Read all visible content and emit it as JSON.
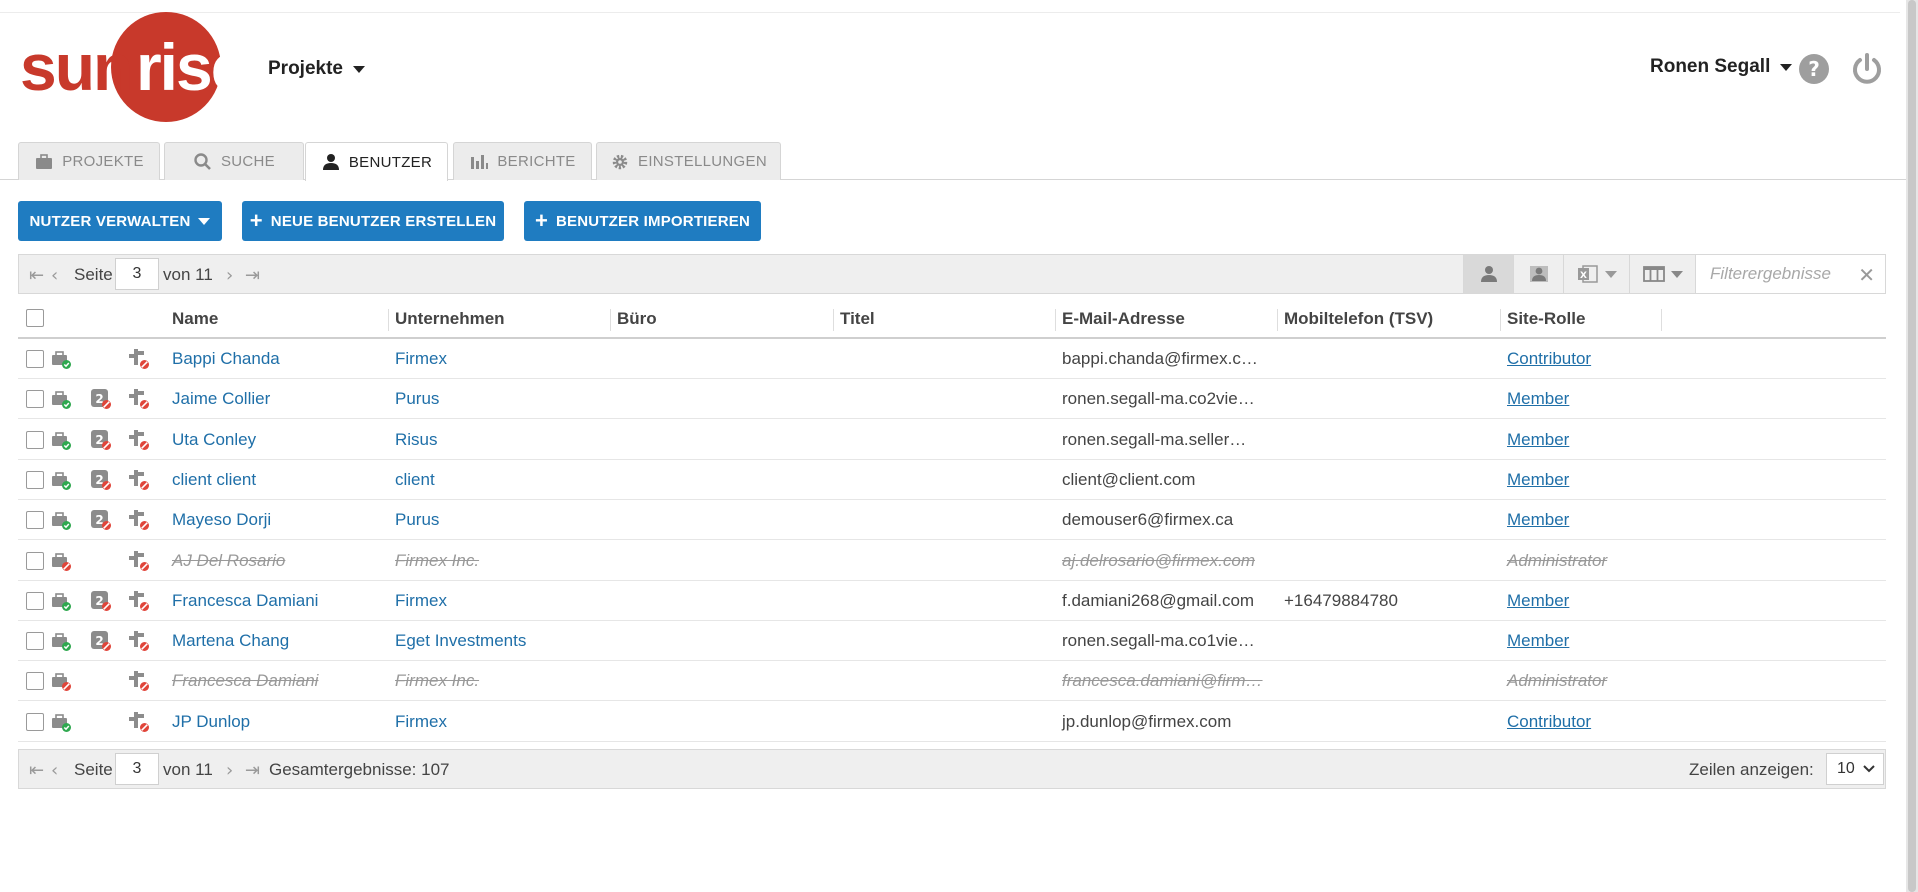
{
  "header": {
    "logo_text": "sunrise",
    "projects_label": "Projekte",
    "user_name": "Ronen Segall"
  },
  "tabs": [
    {
      "label": "PROJEKTE",
      "icon": "briefcase-icon",
      "active": false
    },
    {
      "label": "SUCHE",
      "icon": "search-icon",
      "active": false
    },
    {
      "label": "BENUTZER",
      "icon": "user-icon",
      "active": true
    },
    {
      "label": "BERICHTE",
      "icon": "bar-chart-icon",
      "active": false
    },
    {
      "label": "EINSTELLUNGEN",
      "icon": "gear-icon",
      "active": false
    }
  ],
  "actions": {
    "manage_users": "NUTZER VERWALTEN",
    "new_user": "NEUE BENUTZER ERSTELLEN",
    "import_users": "BENUTZER IMPORTIEREN"
  },
  "pager_top": {
    "page_label": "Seite",
    "page": "3",
    "of_label": "von 11",
    "filter_placeholder": "Filterergebnisse"
  },
  "table": {
    "columns": [
      "Name",
      "Unternehmen",
      "Büro",
      "Titel",
      "E-Mail-Adresse",
      "Mobiltelefon (TSV)",
      "Site-Rolle"
    ],
    "rows": [
      {
        "name": "Bappi Chanda",
        "company": "Firmex",
        "office": "",
        "title": "",
        "email": "bappi.chanda@firmex.c…",
        "mobile": "",
        "role": "Contributor",
        "deleted": false,
        "twofa": false
      },
      {
        "name": "Jaime Collier",
        "company": "Purus",
        "office": "",
        "title": "",
        "email": "ronen.segall-ma.co2vie…",
        "mobile": "",
        "role": "Member",
        "deleted": false,
        "twofa": true
      },
      {
        "name": "Uta Conley",
        "company": "Risus",
        "office": "",
        "title": "",
        "email": "ronen.segall-ma.seller…",
        "mobile": "",
        "role": "Member",
        "deleted": false,
        "twofa": true
      },
      {
        "name": "client client",
        "company": "client",
        "office": "",
        "title": "",
        "email": "client@client.com",
        "mobile": "",
        "role": "Member",
        "deleted": false,
        "twofa": true
      },
      {
        "name": "Mayeso Dorji",
        "company": "Purus",
        "office": "",
        "title": "",
        "email": "demouser6@firmex.ca",
        "mobile": "",
        "role": "Member",
        "deleted": false,
        "twofa": true
      },
      {
        "name": "AJ Del Rosario",
        "company": "Firmex Inc.",
        "office": "",
        "title": "",
        "email": "aj.delrosario@firmex.com",
        "mobile": "",
        "role": "Administrator",
        "deleted": true,
        "twofa": false
      },
      {
        "name": "Francesca Damiani",
        "company": "Firmex",
        "office": "",
        "title": "",
        "email": "f.damiani268@gmail.com",
        "mobile": "+16479884780",
        "role": "Member",
        "deleted": false,
        "twofa": true
      },
      {
        "name": "Martena Chang",
        "company": "Eget Investments",
        "office": "",
        "title": "",
        "email": "ronen.segall-ma.co1vie…",
        "mobile": "",
        "role": "Member",
        "deleted": false,
        "twofa": true
      },
      {
        "name": "Francesca Damiani",
        "company": "Firmex Inc.",
        "office": "",
        "title": "",
        "email": "francesca.damiani@firm…",
        "mobile": "",
        "role": "Administrator",
        "deleted": true,
        "twofa": false
      },
      {
        "name": "JP Dunlop",
        "company": "Firmex",
        "office": "",
        "title": "",
        "email": "jp.dunlop@firmex.com",
        "mobile": "",
        "role": "Contributor",
        "deleted": false,
        "twofa": false
      }
    ]
  },
  "pager_bottom": {
    "page_label": "Seite",
    "page": "3",
    "of_label": "von 11",
    "total_label": "Gesamtergebnisse: 107",
    "rows_label": "Zeilen anzeigen:",
    "rows_value": "10"
  },
  "colors": {
    "brand_red": "#c8392b",
    "primary_blue": "#1f7cc1",
    "link_blue": "#1f6fa8"
  }
}
